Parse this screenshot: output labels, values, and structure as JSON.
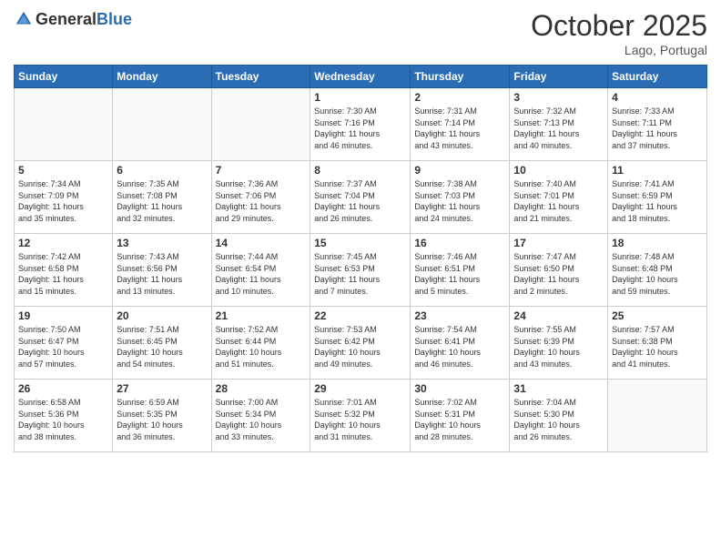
{
  "header": {
    "logo_general": "General",
    "logo_blue": "Blue",
    "month": "October 2025",
    "location": "Lago, Portugal"
  },
  "days_of_week": [
    "Sunday",
    "Monday",
    "Tuesday",
    "Wednesday",
    "Thursday",
    "Friday",
    "Saturday"
  ],
  "weeks": [
    [
      {
        "day": "",
        "content": ""
      },
      {
        "day": "",
        "content": ""
      },
      {
        "day": "",
        "content": ""
      },
      {
        "day": "1",
        "content": "Sunrise: 7:30 AM\nSunset: 7:16 PM\nDaylight: 11 hours\nand 46 minutes."
      },
      {
        "day": "2",
        "content": "Sunrise: 7:31 AM\nSunset: 7:14 PM\nDaylight: 11 hours\nand 43 minutes."
      },
      {
        "day": "3",
        "content": "Sunrise: 7:32 AM\nSunset: 7:13 PM\nDaylight: 11 hours\nand 40 minutes."
      },
      {
        "day": "4",
        "content": "Sunrise: 7:33 AM\nSunset: 7:11 PM\nDaylight: 11 hours\nand 37 minutes."
      }
    ],
    [
      {
        "day": "5",
        "content": "Sunrise: 7:34 AM\nSunset: 7:09 PM\nDaylight: 11 hours\nand 35 minutes."
      },
      {
        "day": "6",
        "content": "Sunrise: 7:35 AM\nSunset: 7:08 PM\nDaylight: 11 hours\nand 32 minutes."
      },
      {
        "day": "7",
        "content": "Sunrise: 7:36 AM\nSunset: 7:06 PM\nDaylight: 11 hours\nand 29 minutes."
      },
      {
        "day": "8",
        "content": "Sunrise: 7:37 AM\nSunset: 7:04 PM\nDaylight: 11 hours\nand 26 minutes."
      },
      {
        "day": "9",
        "content": "Sunrise: 7:38 AM\nSunset: 7:03 PM\nDaylight: 11 hours\nand 24 minutes."
      },
      {
        "day": "10",
        "content": "Sunrise: 7:40 AM\nSunset: 7:01 PM\nDaylight: 11 hours\nand 21 minutes."
      },
      {
        "day": "11",
        "content": "Sunrise: 7:41 AM\nSunset: 6:59 PM\nDaylight: 11 hours\nand 18 minutes."
      }
    ],
    [
      {
        "day": "12",
        "content": "Sunrise: 7:42 AM\nSunset: 6:58 PM\nDaylight: 11 hours\nand 15 minutes."
      },
      {
        "day": "13",
        "content": "Sunrise: 7:43 AM\nSunset: 6:56 PM\nDaylight: 11 hours\nand 13 minutes."
      },
      {
        "day": "14",
        "content": "Sunrise: 7:44 AM\nSunset: 6:54 PM\nDaylight: 11 hours\nand 10 minutes."
      },
      {
        "day": "15",
        "content": "Sunrise: 7:45 AM\nSunset: 6:53 PM\nDaylight: 11 hours\nand 7 minutes."
      },
      {
        "day": "16",
        "content": "Sunrise: 7:46 AM\nSunset: 6:51 PM\nDaylight: 11 hours\nand 5 minutes."
      },
      {
        "day": "17",
        "content": "Sunrise: 7:47 AM\nSunset: 6:50 PM\nDaylight: 11 hours\nand 2 minutes."
      },
      {
        "day": "18",
        "content": "Sunrise: 7:48 AM\nSunset: 6:48 PM\nDaylight: 10 hours\nand 59 minutes."
      }
    ],
    [
      {
        "day": "19",
        "content": "Sunrise: 7:50 AM\nSunset: 6:47 PM\nDaylight: 10 hours\nand 57 minutes."
      },
      {
        "day": "20",
        "content": "Sunrise: 7:51 AM\nSunset: 6:45 PM\nDaylight: 10 hours\nand 54 minutes."
      },
      {
        "day": "21",
        "content": "Sunrise: 7:52 AM\nSunset: 6:44 PM\nDaylight: 10 hours\nand 51 minutes."
      },
      {
        "day": "22",
        "content": "Sunrise: 7:53 AM\nSunset: 6:42 PM\nDaylight: 10 hours\nand 49 minutes."
      },
      {
        "day": "23",
        "content": "Sunrise: 7:54 AM\nSunset: 6:41 PM\nDaylight: 10 hours\nand 46 minutes."
      },
      {
        "day": "24",
        "content": "Sunrise: 7:55 AM\nSunset: 6:39 PM\nDaylight: 10 hours\nand 43 minutes."
      },
      {
        "day": "25",
        "content": "Sunrise: 7:57 AM\nSunset: 6:38 PM\nDaylight: 10 hours\nand 41 minutes."
      }
    ],
    [
      {
        "day": "26",
        "content": "Sunrise: 6:58 AM\nSunset: 5:36 PM\nDaylight: 10 hours\nand 38 minutes."
      },
      {
        "day": "27",
        "content": "Sunrise: 6:59 AM\nSunset: 5:35 PM\nDaylight: 10 hours\nand 36 minutes."
      },
      {
        "day": "28",
        "content": "Sunrise: 7:00 AM\nSunset: 5:34 PM\nDaylight: 10 hours\nand 33 minutes."
      },
      {
        "day": "29",
        "content": "Sunrise: 7:01 AM\nSunset: 5:32 PM\nDaylight: 10 hours\nand 31 minutes."
      },
      {
        "day": "30",
        "content": "Sunrise: 7:02 AM\nSunset: 5:31 PM\nDaylight: 10 hours\nand 28 minutes."
      },
      {
        "day": "31",
        "content": "Sunrise: 7:04 AM\nSunset: 5:30 PM\nDaylight: 10 hours\nand 26 minutes."
      },
      {
        "day": "",
        "content": ""
      }
    ]
  ]
}
